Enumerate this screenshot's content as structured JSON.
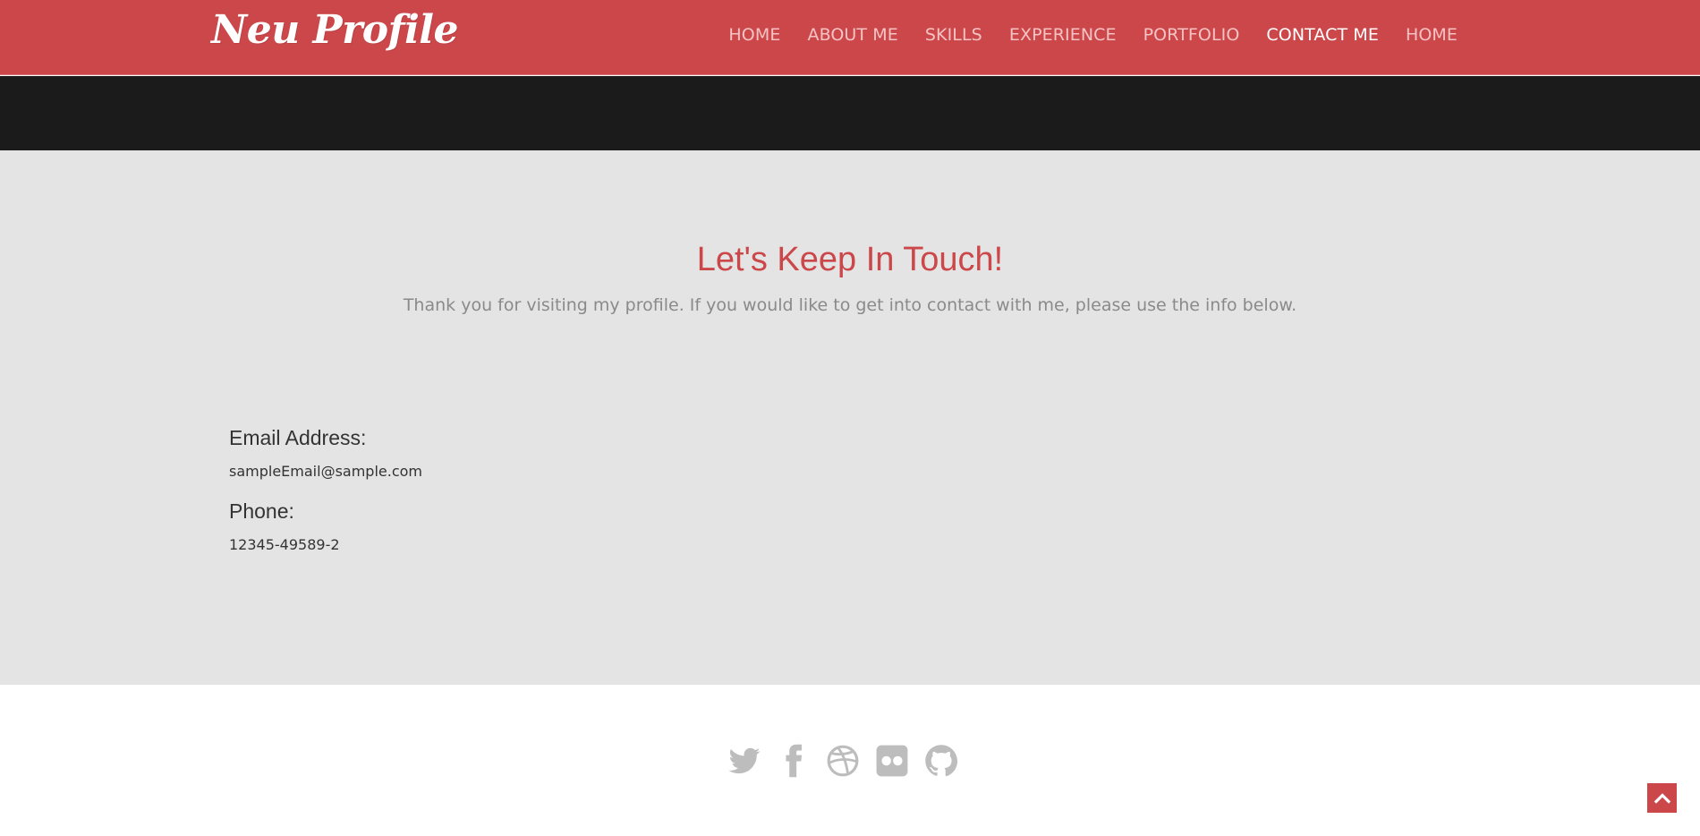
{
  "header": {
    "brand": "Neu Profile",
    "nav": [
      {
        "label": "HOME",
        "active": false
      },
      {
        "label": "ABOUT ME",
        "active": false
      },
      {
        "label": "SKILLS",
        "active": false
      },
      {
        "label": "EXPERIENCE",
        "active": false
      },
      {
        "label": "PORTFOLIO",
        "active": false
      },
      {
        "label": "CONTACT ME",
        "active": true
      },
      {
        "label": "HOME",
        "active": false
      }
    ]
  },
  "contact": {
    "title": "Let's Keep In Touch!",
    "subtitle": "Thank you for visiting my profile. If you would like to get into contact with me, please use the info below.",
    "email_label": "Email Address:",
    "email_value": "sampleEmail@sample.com",
    "phone_label": "Phone:",
    "phone_value": "12345-49589-2"
  },
  "footer": {
    "social_icons": [
      "twitter-icon",
      "facebook-icon",
      "dribbble-icon",
      "flickr-icon",
      "github-icon"
    ]
  },
  "back_to_top": {
    "icon": "chevron-up-icon"
  },
  "colors": {
    "accent": "#cc474a",
    "dark_band": "#1b1b1b",
    "section_bg": "#e4e4e4",
    "icon_gray": "#bdbdbd"
  }
}
